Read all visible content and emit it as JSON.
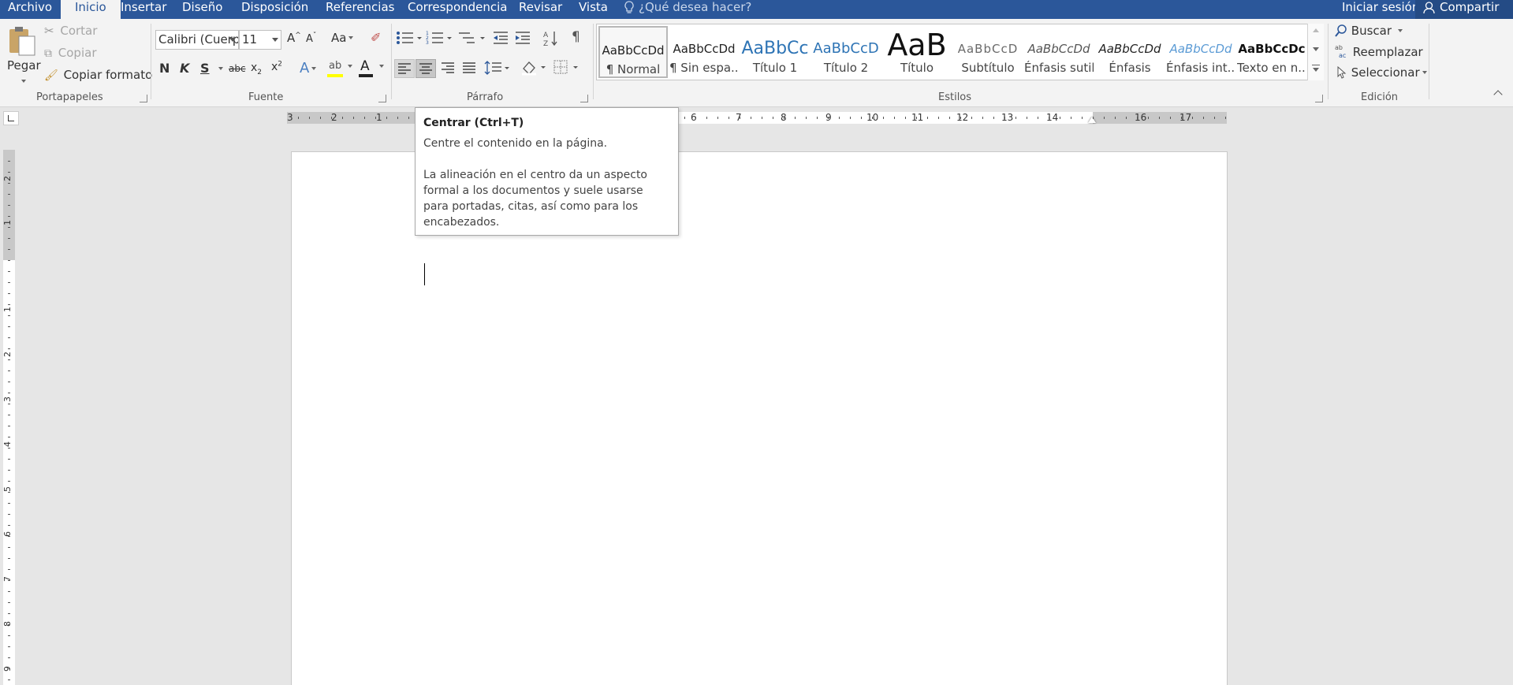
{
  "tabs": [
    {
      "label": "Archivo",
      "active": false
    },
    {
      "label": "Inicio",
      "active": true
    },
    {
      "label": "Insertar",
      "active": false
    },
    {
      "label": "Diseño",
      "active": false
    },
    {
      "label": "Disposición",
      "active": false
    },
    {
      "label": "Referencias",
      "active": false
    },
    {
      "label": "Correspondencia",
      "active": false
    },
    {
      "label": "Revisar",
      "active": false
    },
    {
      "label": "Vista",
      "active": false
    }
  ],
  "tell_me": "¿Qué desea hacer?",
  "account": {
    "signin": "Iniciar sesión",
    "share": "Compartir"
  },
  "clipboard": {
    "paste": "Pegar",
    "cut": "Cortar",
    "copy": "Copiar",
    "format_painter": "Copiar formato",
    "label": "Portapapeles"
  },
  "font": {
    "name": "Calibri (Cuerp",
    "size": "11",
    "label": "Fuente",
    "bold": "N",
    "italic": "K",
    "underline": "S",
    "strike": "abc",
    "change_case": "Aa",
    "font_color": "#c00000",
    "highlight": "#ffff00"
  },
  "paragraph": {
    "label": "Párrafo"
  },
  "styles": {
    "label": "Estilos",
    "items": [
      {
        "preview": "AaBbCcDd",
        "name": "¶ Normal",
        "selected": true
      },
      {
        "preview": "AaBbCcDd",
        "name": "¶ Sin espa..."
      },
      {
        "preview": "AaBbCc",
        "name": "Título 1"
      },
      {
        "preview": "AaBbCcD",
        "name": "Título 2"
      },
      {
        "preview": "AaB",
        "name": "Título"
      },
      {
        "preview": "AaBbCcD",
        "name": "Subtítulo"
      },
      {
        "preview": "AaBbCcDd",
        "name": "Énfasis sutil"
      },
      {
        "preview": "AaBbCcDd",
        "name": "Énfasis"
      },
      {
        "preview": "AaBbCcDd",
        "name": "Énfasis int..."
      },
      {
        "preview": "AaBbCcDc",
        "name": "Texto en n..."
      }
    ]
  },
  "editing": {
    "find": "Buscar",
    "replace": "Reemplazar",
    "select": "Seleccionar",
    "label": "Edición"
  },
  "ruler": {
    "h_marks": [
      "3",
      "2",
      "1",
      "6",
      "7",
      "8",
      "9",
      "10",
      "11",
      "12",
      "13",
      "14",
      "16",
      "17"
    ],
    "v_marks": [
      "2",
      "1",
      "1",
      "2",
      "3",
      "4",
      "5",
      "6",
      "7",
      "8",
      "9"
    ]
  },
  "tooltip": {
    "title": "Centrar (Ctrl+T)",
    "line1": "Centre el contenido en la página.",
    "line2": "La alineación en el centro da un aspecto formal a los documentos y suele usarse para portadas, citas, así como para los encabezados."
  },
  "colors": {
    "accent": "#2b579a",
    "ribbon": "#f3f3f3",
    "workspace": "#e6e6e6"
  }
}
